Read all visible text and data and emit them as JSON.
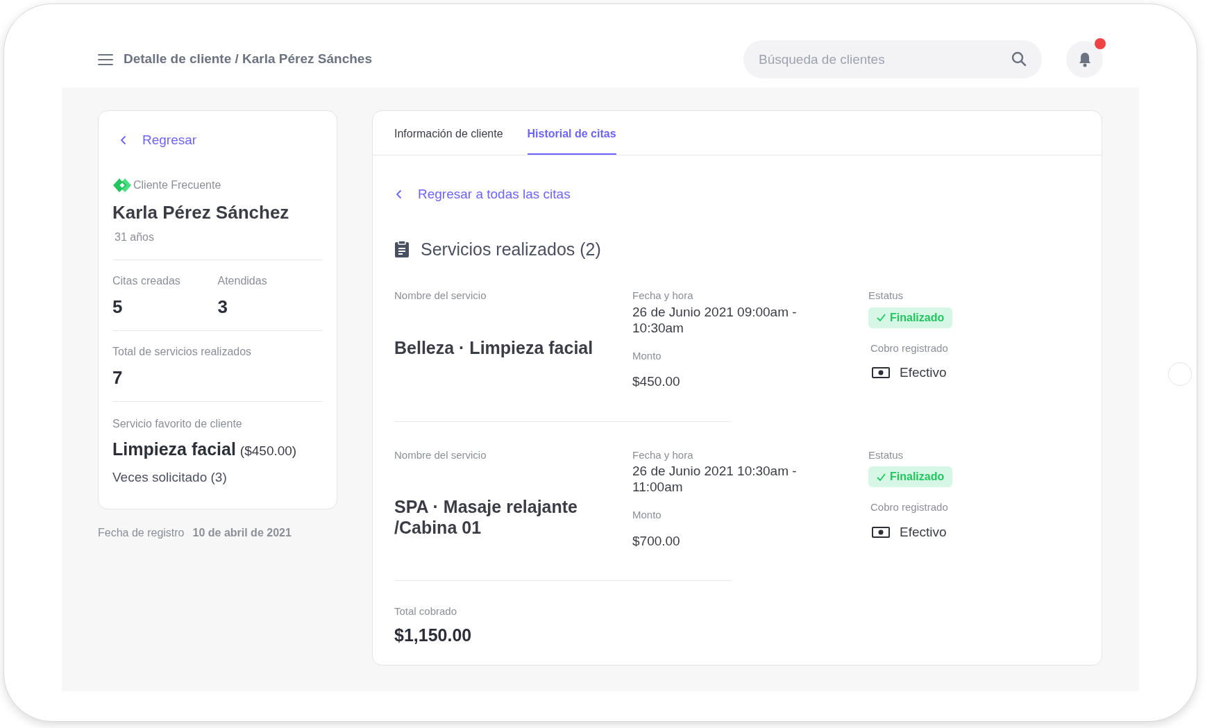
{
  "header": {
    "breadcrumb": "Detalle de cliente / Karla Pérez Sánches",
    "search": {
      "placeholder": "Búsqueda de clientes"
    },
    "notifications": {
      "unread": true
    }
  },
  "client_card": {
    "back_link": "Regresar",
    "badge": "Cliente Frecuente",
    "name": "Karla Pérez Sánchez",
    "age": "31 años",
    "stats": [
      {
        "label": "Citas creadas",
        "value": "5"
      },
      {
        "label": "Atendidas",
        "value": "3"
      }
    ],
    "total": {
      "label": "Total de servicios realizados",
      "value": "7"
    },
    "favorite": {
      "label": "Servicio favorito de cliente",
      "service": "Limpieza facial",
      "price": "($450.00)",
      "times": "Veces solicitado (3)"
    }
  },
  "registration": {
    "label": "Fecha de registro",
    "date": "10 de abril de 2021"
  },
  "tabs": [
    {
      "label": "Información de cliente",
      "selected": false
    },
    {
      "label": "Historial de citas",
      "selected": true
    }
  ],
  "history": {
    "back_link": "Regresar a todas las citas",
    "heading": "Servicios realizados (2)",
    "services": [
      {
        "name_label": "Nombre del servicio",
        "name": "Belleza · Limpieza facial",
        "date_label": "Fecha y hora",
        "date": "26 de Junio 2021 09:00am - 10:30am",
        "amount_label": "Monto",
        "amount": "$450.00",
        "status_label": "Estatus",
        "status": "Finalizado",
        "finalized": true,
        "payment_label": "Cobro registrado",
        "payment": "Efectivo"
      },
      {
        "name_label": "Nombre del servicio",
        "name": "SPA · Masaje relajante /Cabina 01",
        "date_label": "Fecha y hora",
        "date": "26 de Junio 2021 10:30am - 11:00am",
        "amount_label": "Monto",
        "amount": "$700.00",
        "status_label": "Estatus",
        "status": "Finalizado",
        "finalized": true,
        "payment_label": "Cobro registrado",
        "payment": "Efectivo"
      }
    ],
    "total": {
      "label": "Total cobrado",
      "value": "$1,150.00"
    }
  }
}
